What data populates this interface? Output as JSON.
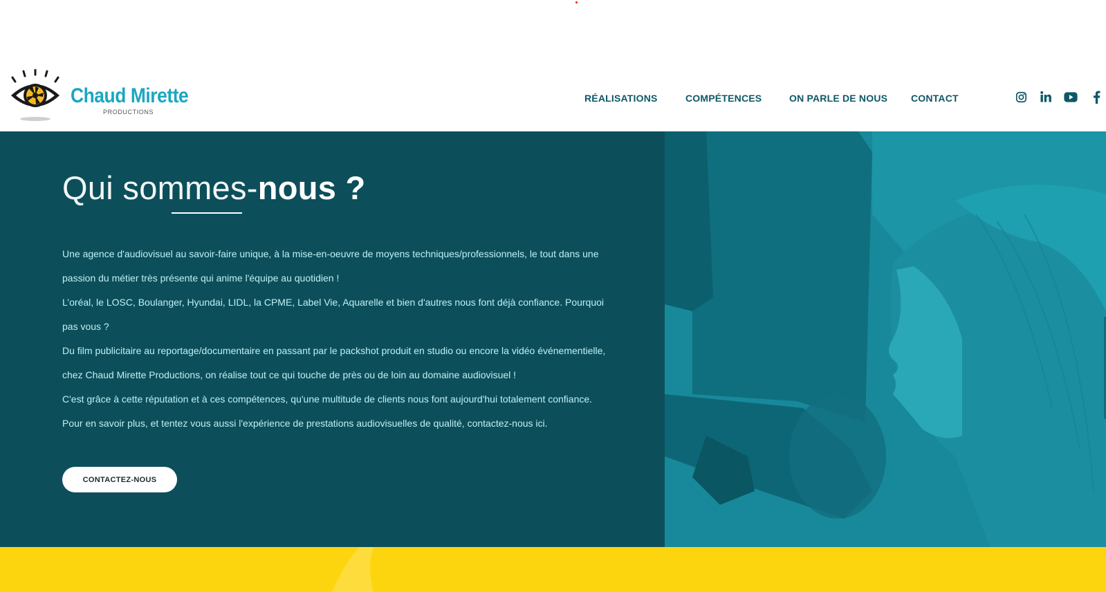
{
  "brand": {
    "name": "Chaud Mirette",
    "subtitle": "PRODUCTIONS"
  },
  "nav": {
    "items": [
      {
        "label": "RÉALISATIONS"
      },
      {
        "label": "COMPÉTENCES"
      },
      {
        "label": "ON PARLE DE NOUS"
      },
      {
        "label": "CONTACT"
      }
    ]
  },
  "socials": [
    "instagram-icon",
    "linkedin-icon",
    "youtube-icon",
    "facebook-icon"
  ],
  "about": {
    "title_light": "Qui sommes-",
    "title_bold": "nous ?",
    "paragraphs": [
      "Une agence d'audiovisuel au savoir-faire unique, à la mise-en-oeuvre de moyens techniques/professionnels, le tout dans une passion du métier très présente qui anime l'équipe au quotidien !",
      "L’oréal, le LOSC, Boulanger, Hyundai, LIDL, la CPME, Label Vie, Aquarelle et bien d'autres nous font déjà confiance. Pourquoi pas vous ?",
      "Du film publicitaire au reportage/documentaire en passant par le packshot produit en studio ou encore la vidéo événementielle, chez Chaud Mirette Productions, on réalise tout ce qui touche de près ou de loin au domaine audiovisuel !",
      "C'est grâce à cette réputation et à ces compétences, qu'une multitude de clients nous font aujourd'hui totalement confiance.",
      "Pour en savoir plus, et tentez vous aussi l'expérience de prestations audiovisuelles de qualité, contactez-nous ici."
    ],
    "cta_label": "CONTACTEZ-NOUS"
  },
  "colors": {
    "teal_dark": "#0c4f5b",
    "teal_photo": "#17899a",
    "accent_blue": "#1aa7c1",
    "nav_text": "#0e5866",
    "yellow": "#fdd50f"
  }
}
